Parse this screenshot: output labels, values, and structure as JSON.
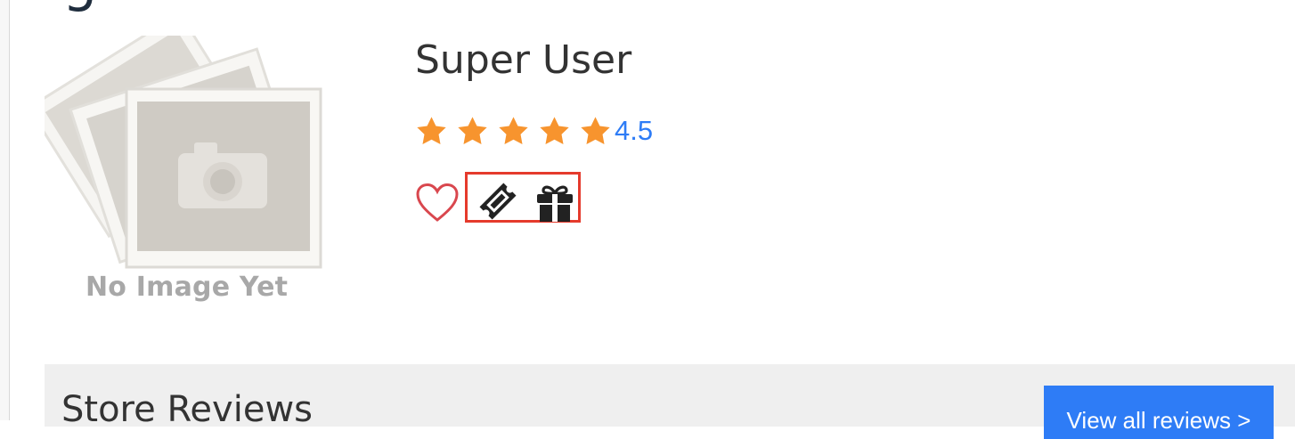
{
  "store": {
    "name": "Super User",
    "rating": 4.5,
    "rating_text": "4.5",
    "image_placeholder_text": "No Image Yet"
  },
  "actions": {
    "favorite_icon": "heart-outline-icon",
    "coupon_icon": "ticket-icon",
    "gift_icon": "gift-icon"
  },
  "reviews": {
    "title": "Store Reviews",
    "view_all_label": "View all reviews >"
  },
  "colors": {
    "accent": "#2e7cf6",
    "star": "#f7942e",
    "heart": "#d9474e",
    "highlight": "#e53a2c",
    "icon": "#222222"
  }
}
